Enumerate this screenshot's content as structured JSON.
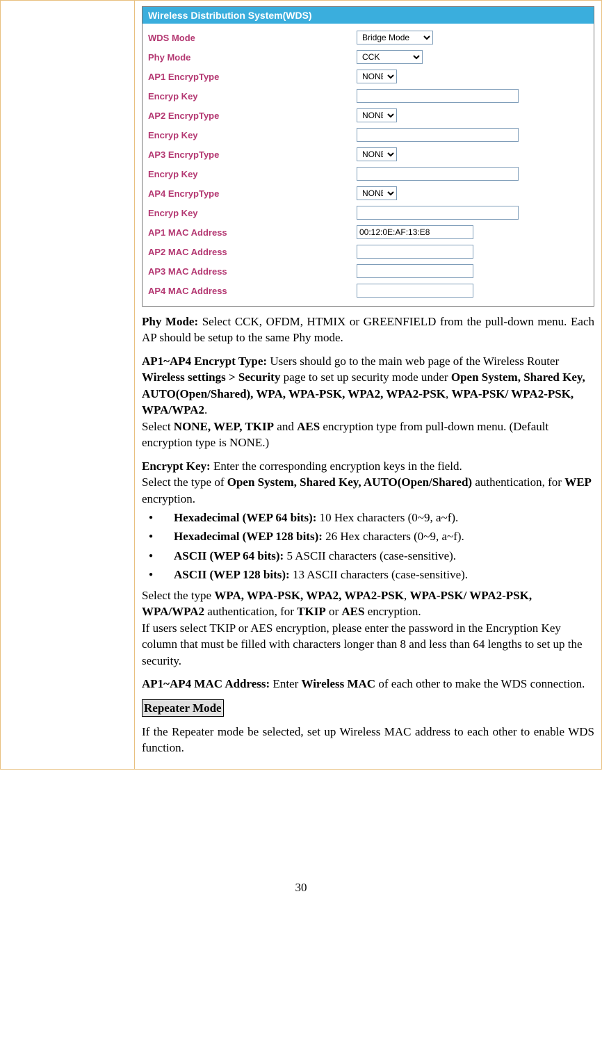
{
  "screenshot": {
    "header": "Wireless Distribution System(WDS)",
    "rows": {
      "wds_mode": {
        "label": "WDS Mode",
        "value": "Bridge Mode"
      },
      "phy_mode": {
        "label": "Phy Mode",
        "value": "CCK"
      },
      "ap1_enc_type": {
        "label": "AP1 EncrypType",
        "value": "NONE"
      },
      "enc_key_1": {
        "label": "Encryp Key",
        "value": ""
      },
      "ap2_enc_type": {
        "label": "AP2 EncrypType",
        "value": "NONE"
      },
      "enc_key_2": {
        "label": "Encryp Key",
        "value": ""
      },
      "ap3_enc_type": {
        "label": "AP3 EncrypType",
        "value": "NONE"
      },
      "enc_key_3": {
        "label": "Encryp Key",
        "value": ""
      },
      "ap4_enc_type": {
        "label": "AP4 EncrypType",
        "value": "NONE"
      },
      "enc_key_4": {
        "label": "Encryp Key",
        "value": ""
      },
      "ap1_mac": {
        "label": "AP1 MAC Address",
        "value": "00:12:0E:AF:13:E8"
      },
      "ap2_mac": {
        "label": "AP2 MAC Address",
        "value": ""
      },
      "ap3_mac": {
        "label": "AP3 MAC Address",
        "value": ""
      },
      "ap4_mac": {
        "label": "AP4 MAC Address",
        "value": ""
      }
    }
  },
  "doc": {
    "phy_b": "Phy Mode:",
    "phy_t": " Select CCK, OFDM, HTMIX or GREENFIELD from the pull-down menu. Each AP should be setup to the same Phy mode.",
    "ap_enc_b1": "AP1~AP4 Encrypt Type:",
    "ap_enc_t1": " Users should go to the main web page of the Wireless  Router ",
    "ap_enc_b2": "Wireless settings > Security",
    "ap_enc_t2": " page to set up security mode under ",
    "ap_enc_b3": "Open System, Shared Key, AUTO(Open/Shared), WPA, WPA-PSK, WPA2, WPA2-PSK",
    "ap_enc_t3": ", ",
    "ap_enc_b4": "WPA-PSK/ WPA2-PSK, WPA/WPA2",
    "ap_enc_t4": ".",
    "ap_enc_t5": "Select ",
    "ap_enc_b5": "NONE, WEP, TKIP",
    "ap_enc_t6": " and ",
    "ap_enc_b6": "AES",
    "ap_enc_t7": "  encryption type from pull-down menu. (Default encryption type is NONE.)",
    "ek_b1": "Encrypt Key:",
    "ek_t1": " Enter the corresponding encryption keys in the field.",
    "ek_t2": "Select the type of ",
    "ek_b2": "Open System, Shared Key, AUTO(Open/Shared)",
    "ek_t3": " authentication, for ",
    "ek_b3": "WEP",
    "ek_t4": " encryption.",
    "bullets": [
      {
        "b": "Hexadecimal (WEP 64 bits):",
        "t": " 10 Hex characters (0~9, a~f)."
      },
      {
        "b": "Hexadecimal (WEP 128 bits):",
        "t": " 26 Hex characters (0~9, a~f)."
      },
      {
        "b": "ASCII (WEP 64 bits):",
        "t": " 5 ASCII characters (case-sensitive)."
      },
      {
        "b": "ASCII (WEP 128 bits):",
        "t": " 13 ASCII characters (case-sensitive)."
      }
    ],
    "sel_t1": "Select the type ",
    "sel_b1": "WPA, WPA-PSK, WPA2, WPA2-PSK",
    "sel_t2": ", ",
    "sel_b2": "WPA-PSK/ WPA2-PSK, WPA/WPA2",
    "sel_t3": " authentication, for  ",
    "sel_b3": "TKIP",
    "sel_t4": " or ",
    "sel_b4": "AES",
    "sel_t5": " encryption.",
    "sel_t6": "If users select TKIP or AES encryption, please enter the password in the Encryption Key column that must be filled with characters longer than 8 and less than 64 lengths to set up the security.",
    "mac_b1": "AP1~AP4 MAC Address:",
    "mac_t1": " Enter ",
    "mac_b2": "Wireless MAC",
    "mac_t2": " of each other to make the WDS connection.",
    "repeater_title": "Repeater Mode",
    "repeater_text": "If the Repeater mode be selected, set up Wireless MAC address to each other to enable WDS function."
  },
  "page_number": "30"
}
